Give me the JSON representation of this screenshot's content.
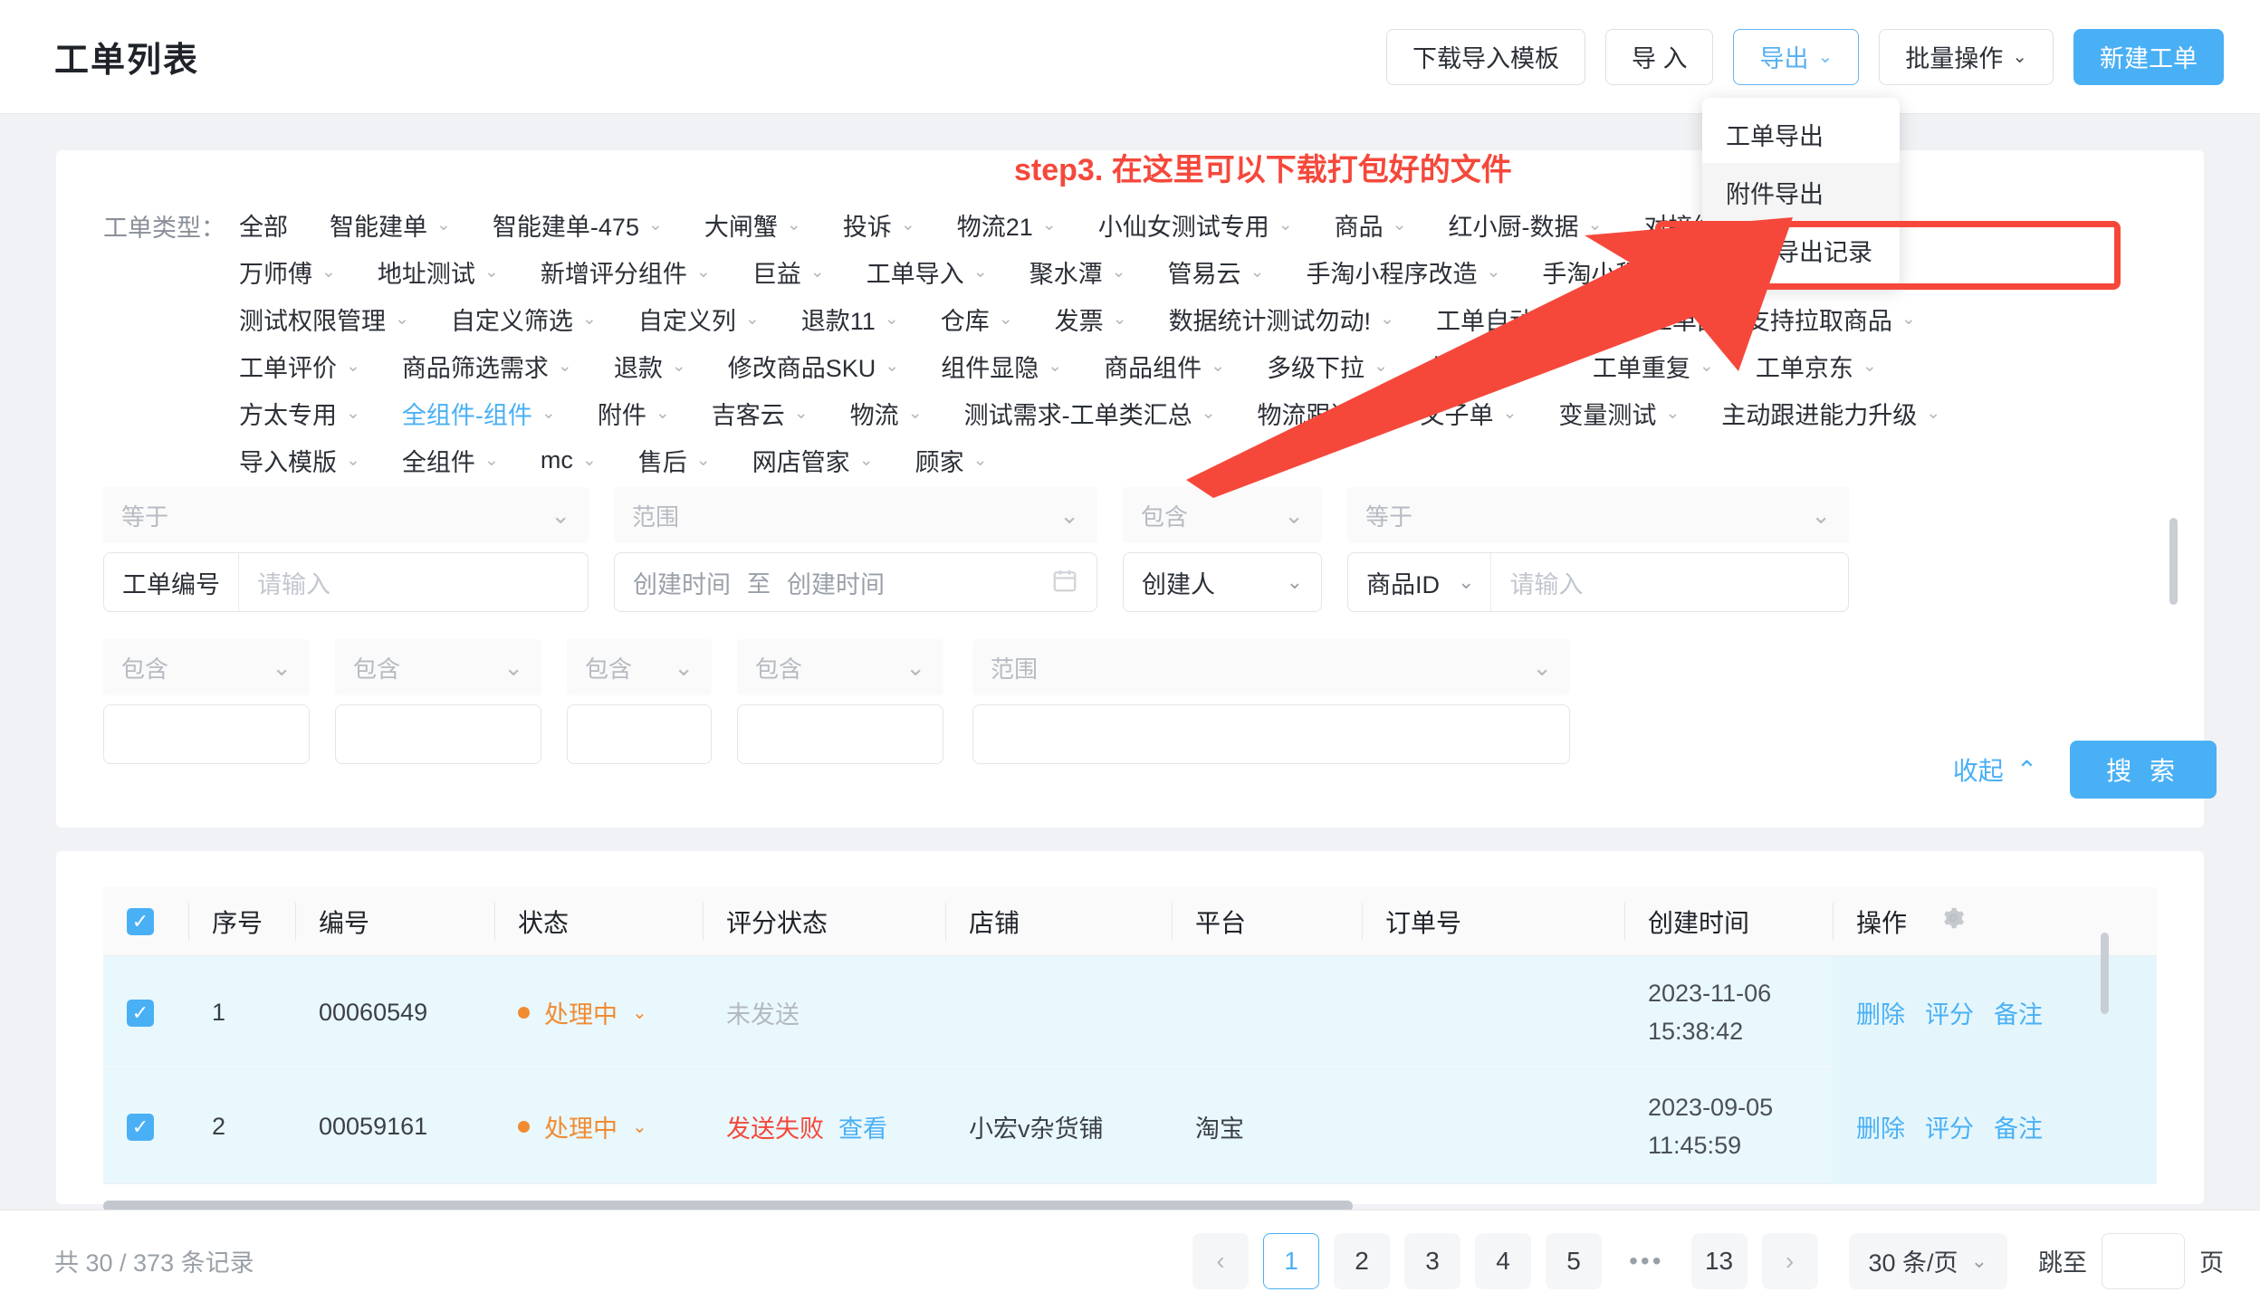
{
  "header": {
    "title": "工单列表",
    "buttons": [
      {
        "label": "下载导入模板",
        "style": "default"
      },
      {
        "label": "导 入",
        "style": "default"
      },
      {
        "label": "导出",
        "style": "active",
        "caret": "⌄"
      },
      {
        "label": "批量操作",
        "style": "default",
        "caret": "⌄"
      },
      {
        "label": "新建工单",
        "style": "primary"
      }
    ]
  },
  "export_menu": {
    "items": [
      "工单导出",
      "附件导出",
      "附件导出记录"
    ],
    "hovered_index": 1
  },
  "annotation": {
    "text": "step3. 在这里可以下载打包好的文件",
    "color": "#f5483b"
  },
  "filters": {
    "type_label": "工单类型：",
    "selected": "全组件-组件",
    "rows": [
      [
        {
          "label": "全部",
          "caret": false
        },
        {
          "label": "智能建单",
          "caret": true
        },
        {
          "label": "智能建单-475",
          "caret": true
        },
        {
          "label": "大闸蟹",
          "caret": true
        },
        {
          "label": "投诉",
          "caret": true
        },
        {
          "label": "物流21",
          "caret": true
        },
        {
          "label": "小仙女测试专用",
          "caret": true
        },
        {
          "label": "商品",
          "caret": true
        },
        {
          "label": "红小厨-数据",
          "caret": true
        },
        {
          "label": "对接组件需求",
          "caret": true
        }
      ],
      [
        {
          "label": "万师傅",
          "caret": true
        },
        {
          "label": "地址测试",
          "caret": true
        },
        {
          "label": "新增评分组件",
          "caret": true
        },
        {
          "label": "巨益",
          "caret": true
        },
        {
          "label": "工单导入",
          "caret": true
        },
        {
          "label": "聚水潭",
          "caret": true
        },
        {
          "label": "管易云",
          "caret": true
        },
        {
          "label": "手淘小程序改造",
          "caret": true
        },
        {
          "label": "手淘小程序",
          "caret": true
        }
      ],
      [
        {
          "label": "测试权限管理",
          "caret": true
        },
        {
          "label": "自定义筛选",
          "caret": true
        },
        {
          "label": "自定义列",
          "caret": true
        },
        {
          "label": "退款11",
          "caret": true
        },
        {
          "label": "仓库",
          "caret": true
        },
        {
          "label": "发票",
          "caret": true
        },
        {
          "label": "数据统计测试勿动!",
          "caret": true
        },
        {
          "label": "工单自动分配",
          "caret": true
        },
        {
          "label": "工单面板支持拉取商品",
          "caret": true
        }
      ],
      [
        {
          "label": "工单评价",
          "caret": true
        },
        {
          "label": "商品筛选需求",
          "caret": true
        },
        {
          "label": "退款",
          "caret": true
        },
        {
          "label": "修改商品SKU",
          "caret": true
        },
        {
          "label": "组件显隐",
          "caret": true
        },
        {
          "label": "商品组件",
          "caret": true
        },
        {
          "label": "多级下拉",
          "caret": true
        },
        {
          "label": "组件测试",
          "caret": true
        },
        {
          "label": "工单重复",
          "caret": true
        },
        {
          "label": "工单京东",
          "caret": true
        }
      ],
      [
        {
          "label": "方太专用",
          "caret": true
        },
        {
          "label": "全组件-组件",
          "caret": true
        },
        {
          "label": "附件",
          "caret": true
        },
        {
          "label": "吉客云",
          "caret": true
        },
        {
          "label": "物流",
          "caret": true
        },
        {
          "label": "测试需求-工单类汇总",
          "caret": true
        },
        {
          "label": "物流跟进",
          "caret": true
        },
        {
          "label": "父子单",
          "caret": true
        },
        {
          "label": "变量测试",
          "caret": true
        },
        {
          "label": "主动跟进能力升级",
          "caret": true
        }
      ],
      [
        {
          "label": "导入模版",
          "caret": true
        },
        {
          "label": "全组件",
          "caret": true
        },
        {
          "label": "mc",
          "caret": true
        },
        {
          "label": "售后",
          "caret": true
        },
        {
          "label": "网店管家",
          "caret": true
        },
        {
          "label": "顾家",
          "caret": true
        }
      ]
    ],
    "fields": [
      {
        "op": "等于",
        "label": "工单编号",
        "label_caret": false,
        "value": "",
        "placeholder": "请输入",
        "kind": "text"
      },
      {
        "op": "范围",
        "label": "创建时间",
        "label_caret": false,
        "value": "",
        "placeholder": "创建时间",
        "placeholder2": "创建时间",
        "separator": "至",
        "kind": "daterange"
      },
      {
        "op": "包含",
        "label": "创建人",
        "label_caret": true,
        "value": "",
        "placeholder": "",
        "kind": "select"
      },
      {
        "op": "等于",
        "label": "商品ID",
        "label_caret": true,
        "value": "",
        "placeholder": "请输入",
        "kind": "text"
      }
    ],
    "fields_row2_ops": [
      "包含",
      "包含",
      "包含",
      "包含",
      "范围"
    ],
    "collapse_label": "收起",
    "search_label": "搜 索"
  },
  "table": {
    "columns": [
      "序号",
      "编号",
      "状态",
      "评分状态",
      "店铺",
      "平台",
      "订单号",
      "创建时间",
      "操作"
    ],
    "settings_icon": "gear-icon",
    "header_checked": true,
    "rows": [
      {
        "checked": true,
        "index": "1",
        "code": "00060549",
        "status": "处理中",
        "score_status": "未发送",
        "score_status_kind": "muted",
        "score_link": "",
        "shop": "",
        "platform": "",
        "order_no": "",
        "created_date": "2023-11-06",
        "created_time": "15:38:42",
        "ops": [
          "删除",
          "评分",
          "备注"
        ]
      },
      {
        "checked": true,
        "index": "2",
        "code": "00059161",
        "status": "处理中",
        "score_status": "发送失败",
        "score_status_kind": "red",
        "score_link": "查看",
        "shop": "小宏v杂货铺",
        "platform": "淘宝",
        "order_no": "",
        "created_date": "2023-09-05",
        "created_time": "11:45:59",
        "ops": [
          "删除",
          "评分",
          "备注"
        ]
      }
    ]
  },
  "footer": {
    "total_text": "共 30 / 373 条记录",
    "prev": "‹",
    "next": "›",
    "pages": [
      "1",
      "2",
      "3",
      "4",
      "5"
    ],
    "ellipsis": "•••",
    "last_page": "13",
    "current_page": "1",
    "page_size": "30 条/页",
    "jump_label": "跳至",
    "jump_value": "",
    "jump_unit": "页"
  }
}
